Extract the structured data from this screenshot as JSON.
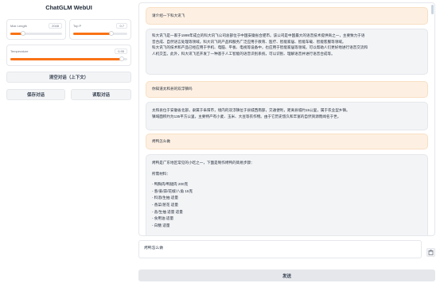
{
  "app": {
    "title": "ChatGLM WebUI"
  },
  "sliders": {
    "max_length": {
      "label": "Max Length",
      "value": "2048",
      "fraction": 0.25
    },
    "top_p": {
      "label": "Top P",
      "value": "0.7",
      "fraction": 0.7
    },
    "temperature": {
      "label": "Temperature",
      "value": "0.95",
      "fraction": 0.95
    }
  },
  "buttons": {
    "clear": "清空对话（上下文）",
    "save": "保存对话",
    "load": "读取对话",
    "send": "发送"
  },
  "chat": [
    {
      "role": "user",
      "lines": [
        "请介绍一下科大讯飞"
      ]
    },
    {
      "role": "bot",
      "lines": [
        "科大讯飞是一家于1999年成立的科大讯飞公司总部位于中国安徽省合肥市。该公司是中国最大的语音技术提供商之一，主要致力于语",
        "音合成、自然语言处理等领域。科大讯飞的产品和服务广泛应用于教育、医疗、智能家居、智能车载、智能客服等领域。",
        "科大讯飞的技术和产品已经应用于手机、电脑、平板、电视等设备中，也应用于智能家居等领域。可以帮助人们更好地进行语音交流和",
        "人机交互。此外，科大讯飞还开发了一种基于人工智能的语音识别系统，可以识别、理解语音并进行语音合成等。"
      ]
    },
    {
      "role": "user",
      "lines": [
        "你知道太和县的双浮镇吗"
      ]
    },
    {
      "role": "bot",
      "lines": [
        "太和县位于安徽省北部，隶属于阜阳市，境内的双浮镇位于县城西南部，交通便利，距离县城约15公里，属于农业型乡镇。",
        "镇域面积约为135平方公里，主要特产有小麦、玉米、大豆等农作物。由于它历史悠久和丰富的自然资源而闻名于世。"
      ]
    },
    {
      "role": "user",
      "lines": [
        "烤鸭怎么做"
      ]
    },
    {
      "role": "bot",
      "lines": [
        "烤鸭是广东地区常见的小吃之一，下面是制作烤鸭的简易步骤：",
        "",
        "所需材料：",
        "",
        "- 鸭胸肉/鸭腿肉 200克",
        "- 葱/姜/蒜/花椒/八角 15克",
        "- 料酒/生抽 适量",
        "- 香菜/葱花 适量",
        "- 盐/生抽 适量 适量",
        "- 食用油 适量",
        "- 白糖 适量"
      ]
    }
  ],
  "input": {
    "value": "烤鸭怎么做"
  }
}
